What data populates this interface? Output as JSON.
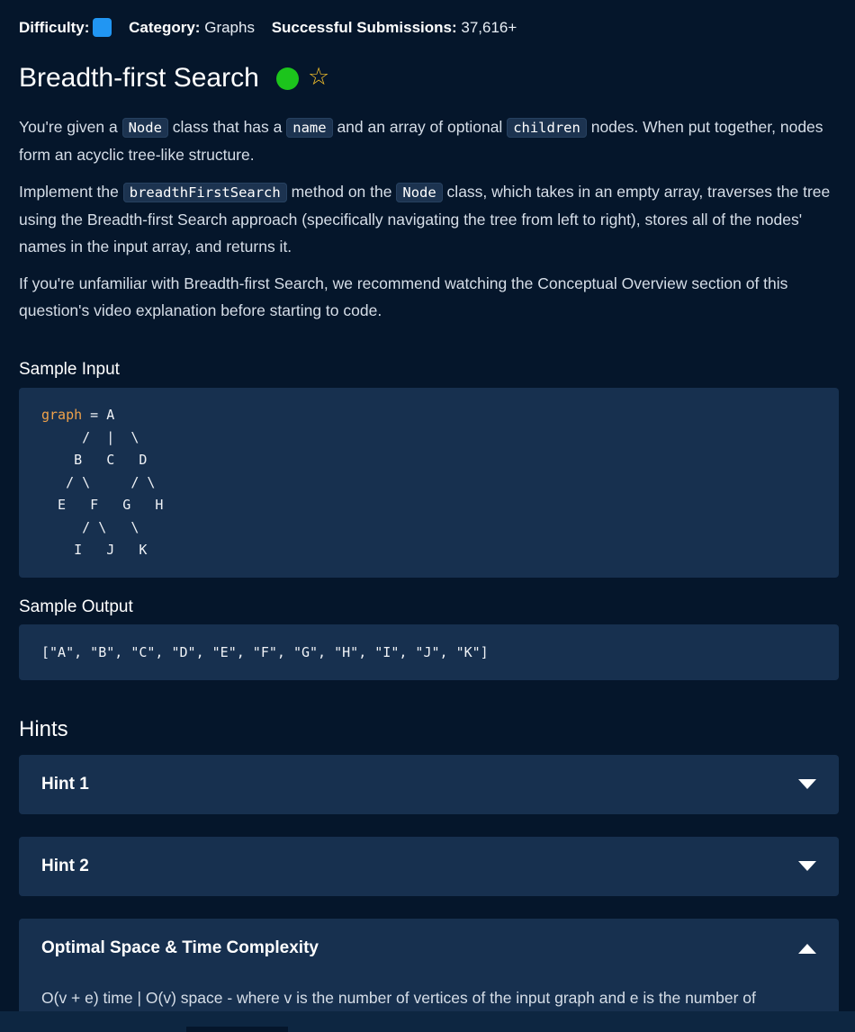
{
  "meta": {
    "difficulty_label": "Difficulty:",
    "difficulty_color": "#2196f3",
    "category_label": "Category:",
    "category_value": "Graphs",
    "submissions_label": "Successful Submissions:",
    "submissions_value": "37,616+"
  },
  "title": "Breadth-first Search",
  "status_icon_color": "#1cc41c",
  "favorite_icon": "star-outline-icon",
  "description": {
    "p1": [
      "You're given a ",
      "Node",
      " class that has a ",
      "name",
      " and an array of optional ",
      "children",
      " nodes. When put together, nodes form an acyclic tree-like structure."
    ],
    "p2": [
      "Implement the ",
      "breadthFirstSearch",
      " method on the ",
      "Node",
      " class, which takes in an empty array, traverses the tree using the Breadth-first Search approach (specifically navigating the tree from left to right), stores all of the nodes' names in the input array, and returns it."
    ],
    "p3": "If you're unfamiliar with Breadth-first Search, we recommend watching the Conceptual Overview section of this question's video explanation before starting to code."
  },
  "sample_input": {
    "heading": "Sample Input",
    "keyword": "graph",
    "first_line_rest": " = A",
    "lines": [
      "     /  |  \\",
      "    B   C   D",
      "   / \\     / \\",
      "  E   F   G   H",
      "     / \\   \\",
      "    I   J   K"
    ]
  },
  "sample_output": {
    "heading": "Sample Output",
    "value": "[\"A\", \"B\", \"C\", \"D\", \"E\", \"F\", \"G\", \"H\", \"I\", \"J\", \"K\"]"
  },
  "hints": {
    "heading": "Hints",
    "items": [
      {
        "label": "Hint 1"
      },
      {
        "label": "Hint 2"
      }
    ],
    "complexity": {
      "label": "Optimal Space & Time Complexity",
      "text": "O(v + e) time | O(v) space - where v is the number of vertices of the input graph and e is the number of"
    }
  }
}
